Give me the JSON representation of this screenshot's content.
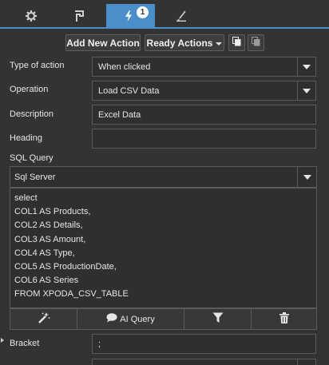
{
  "tabs": [
    {
      "name": "settings",
      "icon": "gear-icon"
    },
    {
      "name": "flag",
      "icon": "flag-icon"
    },
    {
      "name": "actions",
      "icon": "lightning-icon",
      "badge": "1",
      "active": true
    },
    {
      "name": "style",
      "icon": "brush-icon"
    }
  ],
  "toolbar": {
    "add_label": "Add New Action",
    "ready_label": "Ready Actions",
    "copy_icon": "copy-icon",
    "paste_icon": "paste-icon"
  },
  "form": {
    "type_label": "Type of action",
    "type_value": "When clicked",
    "operation_label": "Operation",
    "operation_value": "Load CSV Data",
    "description_label": "Description",
    "description_value": "Excel Data",
    "heading_label": "Heading",
    "heading_value": "",
    "sql_label": "SQL Query",
    "sql_engine": "Sql Server",
    "bracket_label": "Bracket",
    "bracket_value": ";"
  },
  "sql_lines": [
    "select",
    "COL1 AS Products,",
    "COL2 AS Details,",
    "COL3 AS Amount,",
    "COL4 AS Type,",
    "COL5 AS ProductionDate,",
    "COL6 AS Series",
    "FROM XPODA_CSV_TABLE"
  ],
  "sql_toolbar": {
    "ai_label": "AI Query",
    "icons": [
      "magic-wand-icon",
      "chat-bubble-icon",
      "filter-icon",
      "trash-icon"
    ]
  },
  "colors": {
    "accent": "#4a8fc9",
    "background": "#333333",
    "field": "#2f2f2f",
    "border": "#5a5a5a"
  }
}
